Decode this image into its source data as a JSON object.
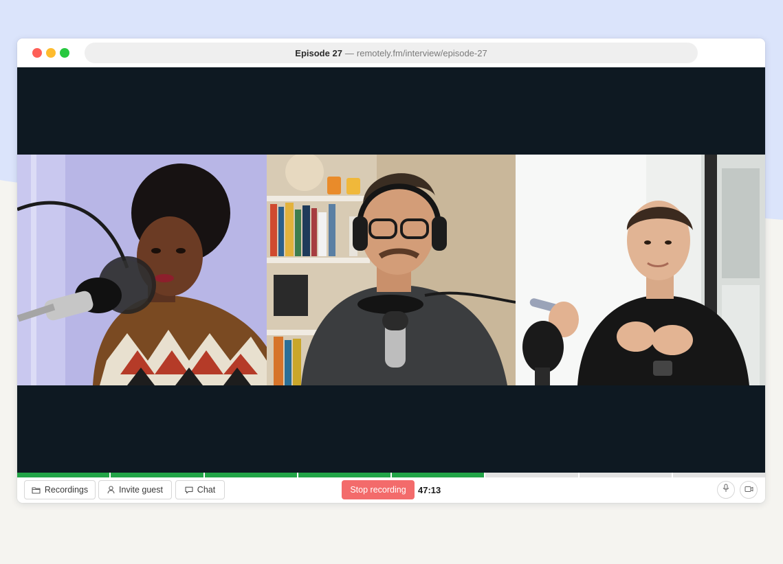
{
  "window": {
    "episode_title": "Episode 27",
    "separator": "—",
    "url": "remotely.fm/interview/episode-27"
  },
  "participants": [
    {
      "name": "participant-1",
      "background": "#b8b6e6"
    },
    {
      "name": "participant-2",
      "background": "#c9b79a"
    },
    {
      "name": "participant-3",
      "background": "#eef0ee"
    }
  ],
  "progress": {
    "segments_total": 8,
    "segments_done": 5,
    "done_color": "#22a447",
    "todo_color": "#e2e2e2"
  },
  "toolbar": {
    "recordings_label": "Recordings",
    "invite_label": "Invite guest",
    "chat_label": "Chat",
    "stop_label": "Stop recording",
    "timer": "47:13"
  },
  "icons": {
    "recordings": "folder-icon",
    "invite": "user-icon",
    "chat": "chat-bubble-icon",
    "mic": "microphone-icon",
    "camera": "video-camera-icon"
  },
  "colors": {
    "stage": "#0e1922",
    "stop_button": "#f36b6b",
    "page_top": "#dbe4fb",
    "page_bottom": "#f5f4f0"
  }
}
